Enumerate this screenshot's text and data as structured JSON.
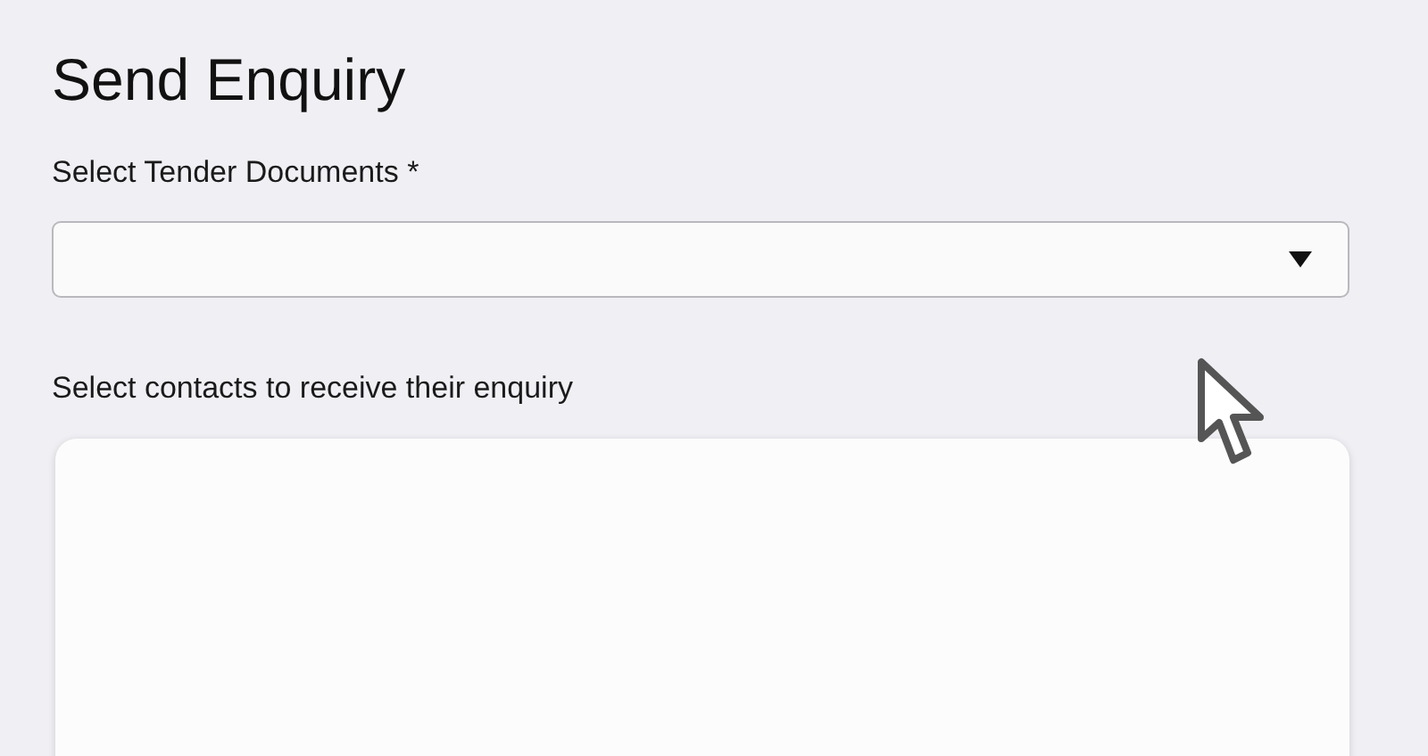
{
  "title": "Send Enquiry",
  "documents_field": {
    "label": "Select Tender Documents *"
  },
  "contacts": {
    "label": "Select contacts to receive their enquiry"
  }
}
